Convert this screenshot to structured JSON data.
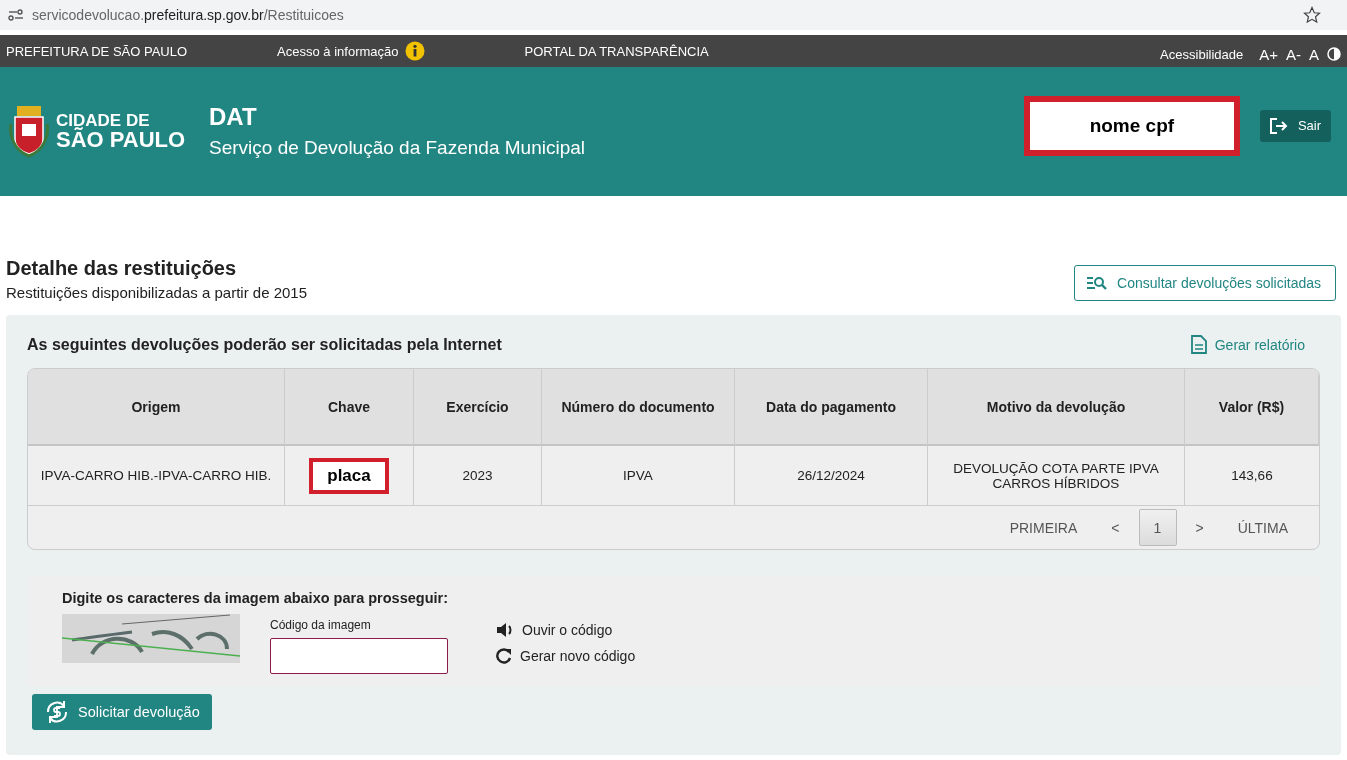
{
  "browser": {
    "url_prefix": "servicodevolucao.",
    "url_domain": "prefeitura.sp.gov.br",
    "url_path": "/Restituicoes"
  },
  "top_bar": {
    "links": [
      "PREFEITURA DE SÃO PAULO",
      "Acesso à informação",
      "PORTAL DA TRANSPARÊNCIA"
    ],
    "accessibility_label": "Acessibilidade",
    "font_controls": [
      "A+",
      "A-",
      "A"
    ]
  },
  "header": {
    "logo_line_1": "CIDADE DE",
    "logo_line_2": "SÃO PAULO",
    "title": "DAT",
    "subtitle": "Serviço de Devolução da Fazenda Municipal",
    "user": "nome cpf",
    "logout": "Sair"
  },
  "page": {
    "title": "Detalhe das restituições",
    "subtitle": "Restituições disponibilizadas a partir de 2015",
    "consult_button": "Consultar devoluções solicitadas"
  },
  "panel": {
    "title": "As seguintes devoluções poderão ser solicitadas pela Internet",
    "report_link": "Gerar relatório"
  },
  "table": {
    "columns": [
      "Origem",
      "Chave",
      "Exercício",
      "Número do documento",
      "Data do pagamento",
      "Motivo da devolução",
      "Valor (R$)"
    ],
    "rows": [
      [
        "IPVA-CARRO HIB.-IPVA-CARRO HIB.",
        "placa",
        "2023",
        "IPVA",
        "26/12/2024",
        "DEVOLUÇÃO COTA PARTE IPVA CARROS HÍBRIDOS",
        "143,66"
      ]
    ]
  },
  "pagination": [
    {
      "label": "PRIMEIRA",
      "selected": false
    },
    {
      "label": "<",
      "selected": false
    },
    {
      "label": "1",
      "selected": true
    },
    {
      "label": ">",
      "selected": false
    },
    {
      "label": "ÚLTIMA",
      "selected": false
    }
  ],
  "captcha": {
    "instruction": "Digite os caracteres da imagem abaixo para prosseguir:",
    "field_label": "Código da imagem",
    "listen": "Ouvir o código",
    "refresh": "Gerar novo código"
  },
  "submit_button": "Solicitar devolução"
}
